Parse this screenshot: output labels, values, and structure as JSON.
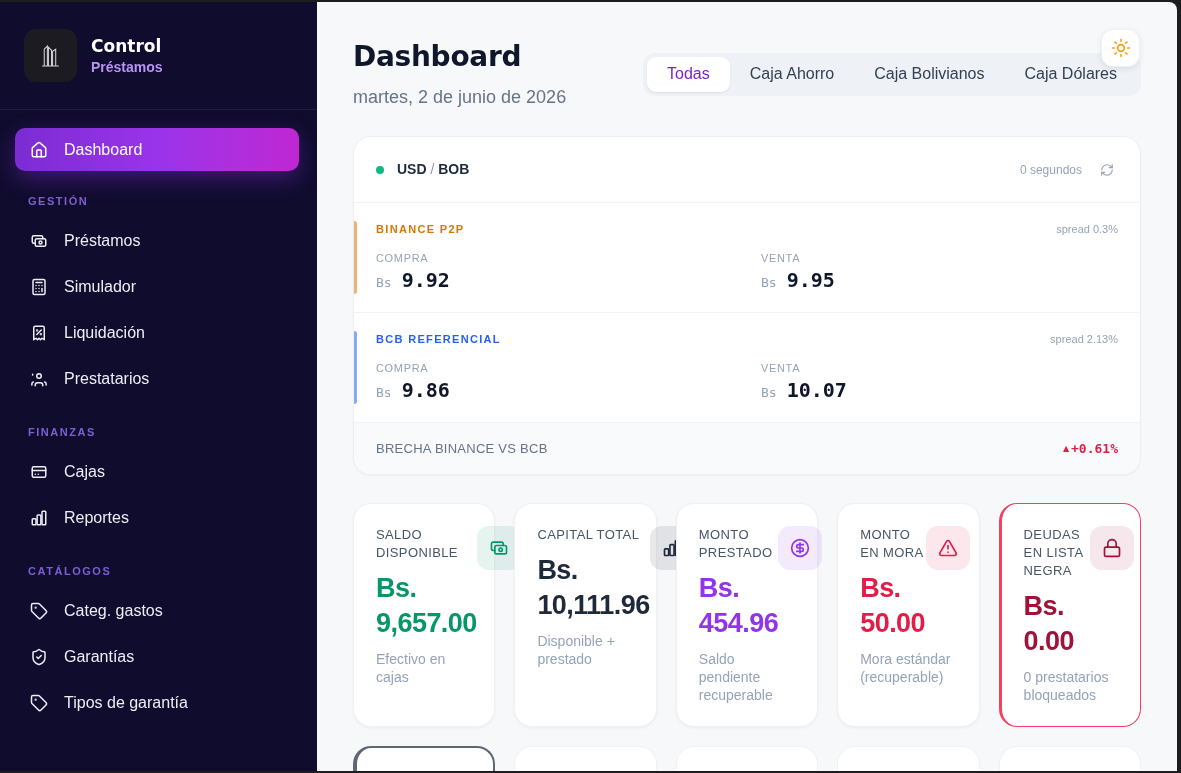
{
  "sidebar": {
    "brand": {
      "title": "Control",
      "subtitle": "Préstamos"
    },
    "items": [
      {
        "label": "Dashboard",
        "selected": true
      }
    ],
    "sections": [
      {
        "title": "GESTIÓN",
        "items": [
          {
            "label": "Préstamos",
            "selected": false
          },
          {
            "label": "Simulador",
            "selected": false
          },
          {
            "label": "Liquidación",
            "selected": false
          },
          {
            "label": "Prestatarios",
            "selected": false
          }
        ]
      },
      {
        "title": "FINANZAS",
        "items": [
          {
            "label": "Cajas",
            "selected": false
          },
          {
            "label": "Reportes",
            "selected": false
          }
        ]
      },
      {
        "title": "CATÁLOGOS",
        "items": [
          {
            "label": "Categ. gastos",
            "selected": false
          },
          {
            "label": "Garantías",
            "selected": false
          },
          {
            "label": "Tipos de garantía",
            "selected": false
          }
        ]
      }
    ]
  },
  "header": {
    "title": "Dashboard",
    "date": "martes, 2 de junio de 2026",
    "tabs": [
      {
        "label": "Todas",
        "selected": true
      },
      {
        "label": "Caja Ahorro",
        "selected": false
      },
      {
        "label": "Caja Bolivianos",
        "selected": false
      },
      {
        "label": "Caja Dólares",
        "selected": false
      }
    ]
  },
  "exchange": {
    "live": true,
    "base": "USD",
    "separator": "/",
    "quote": "BOB",
    "updated": "0 segundos",
    "sources": [
      {
        "name": "BINANCE P2P",
        "color": "#d97706",
        "spread": "spread 0.3%",
        "quotes": [
          {
            "label": "COMPRA",
            "currency": "Bs",
            "value": "9.92"
          },
          {
            "label": "VENTA",
            "currency": "Bs",
            "value": "9.95"
          }
        ]
      },
      {
        "name": "BCB REFERENCIAL",
        "color": "#2563eb",
        "spread": "spread 2.13%",
        "quotes": [
          {
            "label": "COMPRA",
            "currency": "Bs",
            "value": "9.86"
          },
          {
            "label": "VENTA",
            "currency": "Bs",
            "value": "10.07"
          }
        ]
      }
    ],
    "gap": {
      "label": "BRECHA BINANCE VS BCB",
      "arrow": "▲",
      "value": "+0.61%"
    }
  },
  "stats": [
    {
      "label": "SALDO DISPONIBLE",
      "value": "Bs. 9,657.00",
      "note": "Efectivo en cajas",
      "color": "#059669",
      "alert": false
    },
    {
      "label": "CAPITAL TOTAL",
      "value": "Bs. 10,111.96",
      "note": "Disponible + prestado",
      "color": "#1e293b",
      "alert": false
    },
    {
      "label": "MONTO PRESTADO",
      "value": "Bs. 454.96",
      "note": "Saldo pendiente recuperable",
      "color": "#9333ea",
      "alert": false
    },
    {
      "label": "MONTO EN MORA",
      "value": "Bs. 50.00",
      "note": "Mora estándar (recuperable)",
      "color": "#e11d48",
      "alert": false
    },
    {
      "label": "DEUDAS EN LISTA NEGRA",
      "value": "Bs. 0.00",
      "note": "0 prestatarios bloqueados",
      "color": "#9f1239",
      "alert": true
    }
  ],
  "more_cards": [
    {
      "highlighted": true
    },
    {
      "highlighted": false
    },
    {
      "highlighted": false
    },
    {
      "highlighted": false
    },
    {
      "highlighted": false
    }
  ]
}
